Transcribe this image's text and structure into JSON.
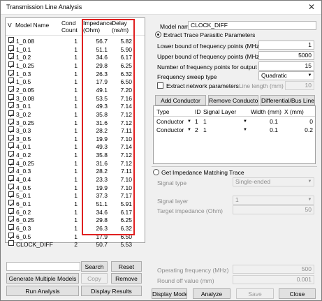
{
  "window": {
    "title": "Transmission Line Analysis",
    "close_symbol": "✕"
  },
  "table": {
    "headers": {
      "v": "V",
      "model": "Model Name",
      "cond": "Cond\nCount",
      "imp": "Impedance\n(Ohm)",
      "delay": "Delay\n(ns/m)"
    },
    "rows": [
      {
        "checked": true,
        "name": "1_0.08",
        "count": "1",
        "imp": "56.7",
        "delay": "5.82"
      },
      {
        "checked": true,
        "name": "1_0.1",
        "count": "1",
        "imp": "51.1",
        "delay": "5.90"
      },
      {
        "checked": true,
        "name": "1_0.2",
        "count": "1",
        "imp": "34.6",
        "delay": "6.17"
      },
      {
        "checked": true,
        "name": "1_0.25",
        "count": "1",
        "imp": "29.8",
        "delay": "6.25"
      },
      {
        "checked": true,
        "name": "1_0.3",
        "count": "1",
        "imp": "26.3",
        "delay": "6.32"
      },
      {
        "checked": true,
        "name": "1_0.5",
        "count": "1",
        "imp": "17.9",
        "delay": "6.50"
      },
      {
        "checked": true,
        "name": "2_0.05",
        "count": "1",
        "imp": "49.1",
        "delay": "7.20"
      },
      {
        "checked": true,
        "name": "3_0.08",
        "count": "1",
        "imp": "53.5",
        "delay": "7.16"
      },
      {
        "checked": true,
        "name": "3_0.1",
        "count": "1",
        "imp": "49.3",
        "delay": "7.14"
      },
      {
        "checked": true,
        "name": "3_0.2",
        "count": "1",
        "imp": "35.8",
        "delay": "7.12"
      },
      {
        "checked": true,
        "name": "3_0.25",
        "count": "1",
        "imp": "31.6",
        "delay": "7.12"
      },
      {
        "checked": true,
        "name": "3_0.3",
        "count": "1",
        "imp": "28.2",
        "delay": "7.11"
      },
      {
        "checked": true,
        "name": "3_0.5",
        "count": "1",
        "imp": "19.9",
        "delay": "7.10"
      },
      {
        "checked": true,
        "name": "4_0.1",
        "count": "1",
        "imp": "49.3",
        "delay": "7.14"
      },
      {
        "checked": true,
        "name": "4_0.2",
        "count": "1",
        "imp": "35.8",
        "delay": "7.12"
      },
      {
        "checked": true,
        "name": "4_0.25",
        "count": "1",
        "imp": "31.6",
        "delay": "7.12"
      },
      {
        "checked": true,
        "name": "4_0.3",
        "count": "1",
        "imp": "28.2",
        "delay": "7.11"
      },
      {
        "checked": true,
        "name": "4_0.4",
        "count": "1",
        "imp": "23.3",
        "delay": "7.10"
      },
      {
        "checked": true,
        "name": "4_0.5",
        "count": "1",
        "imp": "19.9",
        "delay": "7.10"
      },
      {
        "checked": true,
        "name": "5_0.1",
        "count": "1",
        "imp": "37.3",
        "delay": "7.17"
      },
      {
        "checked": true,
        "name": "6_0.1",
        "count": "1",
        "imp": "51.1",
        "delay": "5.91"
      },
      {
        "checked": true,
        "name": "6_0.2",
        "count": "1",
        "imp": "34.6",
        "delay": "6.17"
      },
      {
        "checked": true,
        "name": "6_0.25",
        "count": "1",
        "imp": "29.8",
        "delay": "6.25"
      },
      {
        "checked": true,
        "name": "6_0.3",
        "count": "1",
        "imp": "26.3",
        "delay": "6.32"
      },
      {
        "checked": true,
        "name": "6_0.5",
        "count": "1",
        "imp": "17.9",
        "delay": "6.50"
      },
      {
        "checked": false,
        "name": "CLOCK_DIFF",
        "count": "2",
        "imp": "50.7",
        "delay": "5.53"
      }
    ]
  },
  "left_buttons": {
    "search": "Search",
    "reset": "Reset",
    "generate": "Generate Multiple Models",
    "copy": "Copy",
    "remove": "Remove",
    "run": "Run Analysis",
    "display": "Display Results"
  },
  "model": {
    "label": "Model name",
    "value": "CLOCK_DIFF"
  },
  "extract": {
    "radio_label": "Extract Trace Parasitic Parameters",
    "lower_label": "Lower bound of frequency points (MHz)",
    "lower_value": "1",
    "upper_label": "Upper bound of frequency points (MHz)",
    "upper_value": "5000",
    "num_label": "Number of frequency points for output",
    "num_value": "15",
    "sweep_label": "Frequency sweep type",
    "sweep_value": "Quadratic",
    "network_label": "Extract network parameters",
    "line_len_label": "Line length (mm)",
    "line_len_value": "10",
    "add_conductor": "Add Conductor",
    "remove_conductor": "Remove Conductor",
    "diff_bus": "Differential/Bus Lines"
  },
  "cond_table": {
    "headers": {
      "type": "Type",
      "id": "ID",
      "layer": "Signal Layer",
      "width": "Width (mm)",
      "x": "X (mm)"
    },
    "rows": [
      {
        "type": "Conductor",
        "id": "1",
        "layer": "1",
        "width": "0.1",
        "x": "0"
      },
      {
        "type": "Conductor",
        "id": "2",
        "layer": "1",
        "width": "0.1",
        "x": "0.2"
      }
    ]
  },
  "impedance": {
    "radio_label": "Get Impedance Matching Trace",
    "signal_type_label": "Signal type",
    "signal_type_value": "Single-ended",
    "signal_layer_label": "Signal layer",
    "signal_layer_value": "1",
    "target_label": "Target impedance (Ohm)",
    "target_value": "50",
    "op_freq_label": "Operating frequency (MHz)",
    "op_freq_value": "500",
    "round_label": "Round off value (mm)",
    "round_value": "0.001"
  },
  "bottom_buttons": {
    "display_model": "Display Model",
    "analyze": "Analyze",
    "save": "Save",
    "close": "Close"
  }
}
